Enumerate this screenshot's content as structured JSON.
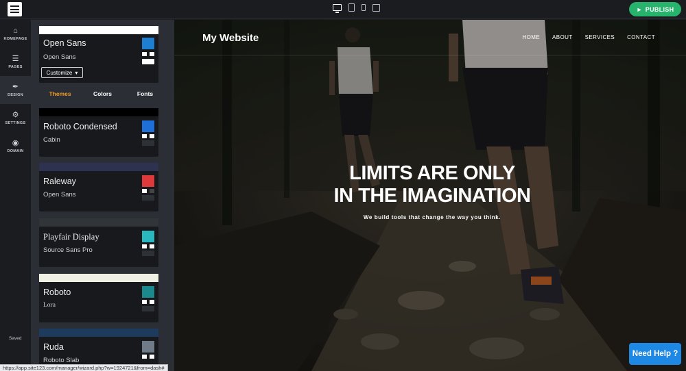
{
  "topbar": {
    "device_icons": [
      "desktop-icon",
      "tablet-icon",
      "phone-icon",
      "popout-icon"
    ],
    "publish_label": "PUBLISH"
  },
  "leftnav": {
    "items": [
      {
        "label": "HOMEPAGE",
        "icon": "home-icon"
      },
      {
        "label": "PAGES",
        "icon": "pages-icon"
      },
      {
        "label": "DESIGN",
        "icon": "brush-icon",
        "active": true
      },
      {
        "label": "SETTINGS",
        "icon": "gear-icon"
      },
      {
        "label": "DOMAIN",
        "icon": "globe-icon"
      }
    ],
    "saved": "Saved"
  },
  "panel": {
    "current": {
      "font1": "Open Sans",
      "font2": "Open Sans",
      "accent": "#1e7fd0",
      "customize_label": "Customize"
    },
    "tabs": [
      "Themes",
      "Colors",
      "Fonts"
    ],
    "active_tab": "Themes",
    "themes": [
      {
        "font1": "Roboto Condensed",
        "font2": "Cabin",
        "strip": "#000000",
        "accent": "#1e6fd8"
      },
      {
        "font1": "Raleway",
        "font2": "Open Sans",
        "strip": "#2e3150",
        "accent": "#e0393b"
      },
      {
        "font1": "Playfair Display",
        "font2": "Source Sans Pro",
        "strip": "#31353a",
        "accent": "#2bb7c0"
      },
      {
        "font1": "Roboto",
        "font2": "Lora",
        "strip": "#eef1e3",
        "accent": "#1a8a8e"
      },
      {
        "font1": "Ruda",
        "font2": "Roboto Slab",
        "strip": "#1e3a5c",
        "accent": "#6f7b88"
      }
    ]
  },
  "preview": {
    "site_title": "My Website",
    "nav": [
      "HOME",
      "ABOUT",
      "SERVICES",
      "CONTACT"
    ],
    "headline_line1": "LIMITS ARE ONLY",
    "headline_line2": "IN THE IMAGINATION",
    "subline": "We build tools that change the way you think.",
    "help_label": "Need Help ?"
  },
  "status_url": "https://app.site123.com/manager/wizard.php?w=1924721&from=dash#"
}
